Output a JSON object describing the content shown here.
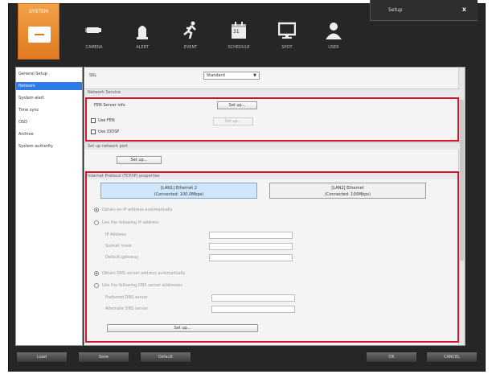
{
  "window": {
    "title": "Setup",
    "close_glyph": "x"
  },
  "tabs": {
    "system": "SYSTEM",
    "items": [
      {
        "label": "CAMERA",
        "icon": "camera-icon"
      },
      {
        "label": "ALERT",
        "icon": "alarm-bell-icon"
      },
      {
        "label": "EVENT",
        "icon": "running-man-icon"
      },
      {
        "label": "SCHEDULE",
        "icon": "calendar-icon"
      },
      {
        "label": "SPOT",
        "icon": "monitor-icon"
      },
      {
        "label": "USER",
        "icon": "user-icon"
      }
    ],
    "calendar_day": "31"
  },
  "nav": {
    "items": [
      "General Setup",
      "Network",
      "System alert",
      "Time sync",
      "OSD",
      "Archive",
      "System authority"
    ],
    "active_index": 1
  },
  "content": {
    "ssl_label": "SSL",
    "ssl_value": "Standard",
    "network_service_header": "Network Service",
    "fen_server_info": "FEN Server info",
    "setup_button": "Set up...",
    "use_fen": "Use FEN",
    "use_ddsp": "Use IDDSP",
    "sub_header": "Set up network port",
    "ip_header": "Internet Protocol (TCP/IP) properties",
    "lan1_title": "[LAN1] Ethernet 2",
    "lan1_status": "(Connected: 100.0Mbps)",
    "lan2_title": "[LAN2] Ethernet",
    "lan2_status": "(Connected: 100Mbps)",
    "obtain_ip_auto": "Obtain an IP address automatically",
    "use_following_ip": "Use the following IP address",
    "ip_address": "IP Address",
    "subnet_mask": "Subnet mask",
    "default_gateway": "Default gateway",
    "obtain_dns_auto": "Obtain DNS server address automatically",
    "use_following_dns": "Use the following DNS server addresses",
    "preferred_dns": "Preferred DNS server",
    "alternate_dns": "Alternate DNS server"
  },
  "footer": {
    "load": "Load",
    "save": "Save",
    "default": "Default",
    "ok": "OK",
    "cancel": "CANCEL"
  },
  "colors": {
    "accent": "#e07a1e",
    "highlight": "#d8142a",
    "selection": "#2f7be5"
  }
}
